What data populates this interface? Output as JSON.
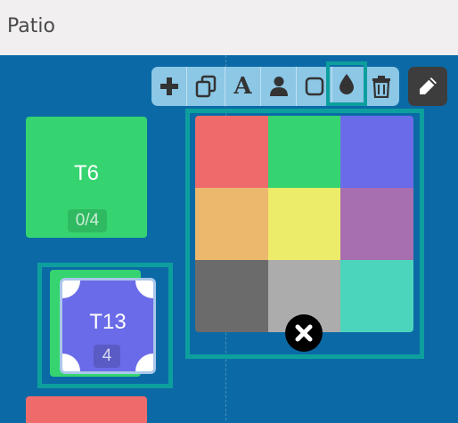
{
  "header": {
    "title": "Patio"
  },
  "toolbar": {
    "buttons": [
      {
        "name": "add-icon"
      },
      {
        "name": "duplicate-icon"
      },
      {
        "name": "text-icon",
        "glyph": "A"
      },
      {
        "name": "person-icon"
      },
      {
        "name": "square-icon"
      },
      {
        "name": "droplet-icon",
        "active": true
      },
      {
        "name": "trash-icon"
      }
    ],
    "edit": {
      "name": "pencil-icon"
    }
  },
  "tables": {
    "t6": {
      "label": "T6",
      "seats": "0/4",
      "color": "#36d470"
    },
    "t13": {
      "label": "T13",
      "seats": "4",
      "color": "#6a6be8"
    },
    "bottom": {
      "color": "#ef6b6b"
    }
  },
  "palette": {
    "colors": [
      "#ef6b6b",
      "#36d470",
      "#6a6be8",
      "#ecb86e",
      "#eceb6a",
      "#a86fb0",
      "#6b6b6b",
      "#acacac",
      "#4cd5bd"
    ],
    "close": {
      "name": "close-icon"
    }
  },
  "theme": {
    "background": "#0b6aa5",
    "selection": "#0d9f9d",
    "toolbar": "#8cc7e6"
  }
}
